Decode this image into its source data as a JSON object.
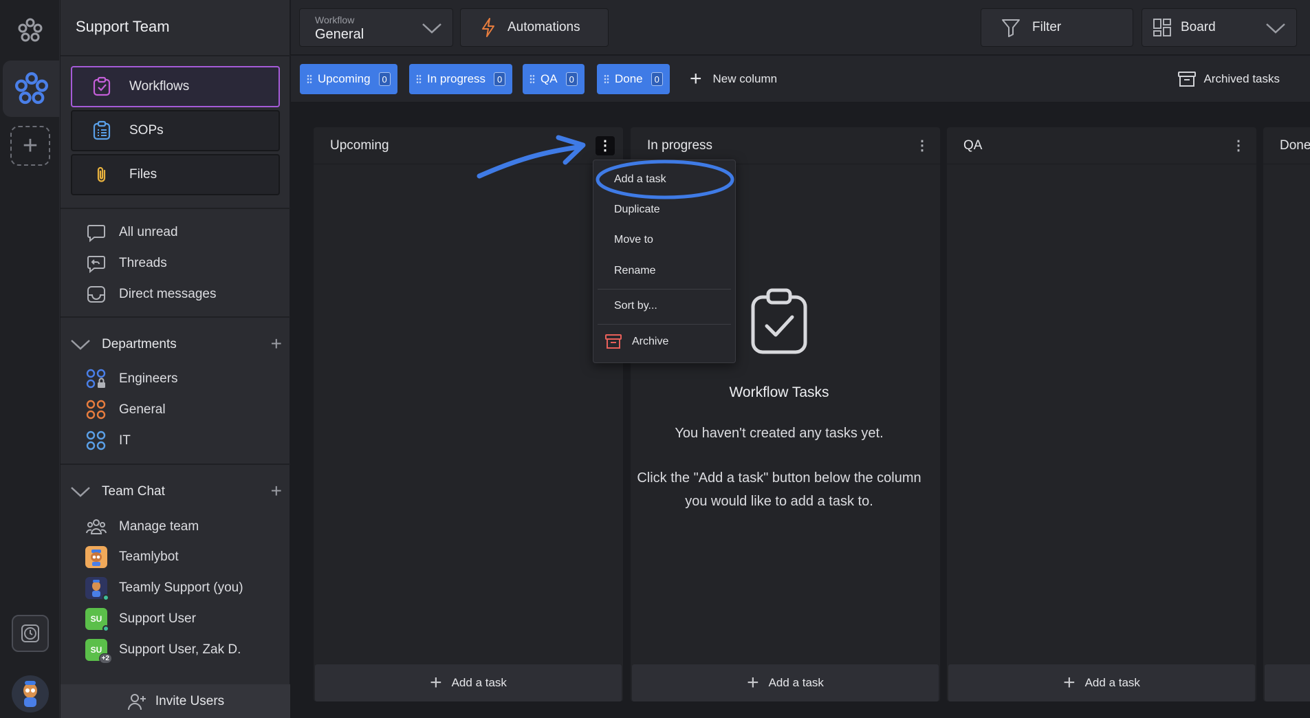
{
  "sidebar": {
    "team_title": "Support Team",
    "main_buttons": [
      {
        "label": "Workflows",
        "icon": "clipboard-check-icon",
        "active": true
      },
      {
        "label": "SOPs",
        "icon": "clipboard-list-icon"
      },
      {
        "label": "Files",
        "icon": "paperclip-icon"
      }
    ],
    "quick_items": [
      {
        "label": "All unread",
        "icon": "chat-bubble-icon"
      },
      {
        "label": "Threads",
        "icon": "thread-reply-icon"
      },
      {
        "label": "Direct messages",
        "icon": "inbox-icon"
      }
    ],
    "departments": {
      "title": "Departments",
      "items": [
        {
          "label": "Engineers",
          "icon": "locked-group-icon",
          "color": "#4a7fe8"
        },
        {
          "label": "General",
          "icon": "group-icon",
          "color": "#e87d3e"
        },
        {
          "label": "IT",
          "icon": "group-icon",
          "color": "#5aa0e8"
        }
      ]
    },
    "team_chat": {
      "title": "Team Chat",
      "manage": "Manage team",
      "members": [
        {
          "label": "Teamlybot",
          "avatar_bg": "#f0a95a"
        },
        {
          "label": "Teamly Support (you)",
          "avatar_bg": "#2e3560"
        },
        {
          "label": "Support User",
          "avatar_text": "SU",
          "avatar_bg": "#5bbf4a"
        },
        {
          "label": "Support User, Zak D.",
          "avatar_text": "SU",
          "avatar_bg": "#5bbf4a",
          "badge": "+2"
        }
      ]
    },
    "invite": "Invite Users"
  },
  "topbar": {
    "workflow_label": "Workflow",
    "workflow_value": "General",
    "automations": "Automations",
    "filter": "Filter",
    "view": "Board"
  },
  "tabs": {
    "columns": [
      {
        "label": "Upcoming",
        "count": "0"
      },
      {
        "label": "In progress",
        "count": "0"
      },
      {
        "label": "QA",
        "count": "0"
      },
      {
        "label": "Done",
        "count": "0"
      }
    ],
    "new_column": "New column",
    "archived": "Archived tasks"
  },
  "board": {
    "columns": [
      "Upcoming",
      "In progress",
      "QA",
      "Done"
    ],
    "add_task": "Add a task",
    "empty": {
      "title": "Workflow Tasks",
      "line1": "You haven't created any tasks yet.",
      "line2": "Click the \"Add a task\" button below the column",
      "line3": "you would like to add a task to."
    }
  },
  "context_menu": {
    "items": [
      "Add a task",
      "Duplicate",
      "Move to",
      "Rename",
      "Sort by...",
      "Archive"
    ]
  },
  "colors": {
    "accent": "#3f7be6",
    "active_border": "#a55bd8",
    "annotation": "#3f7be6"
  }
}
